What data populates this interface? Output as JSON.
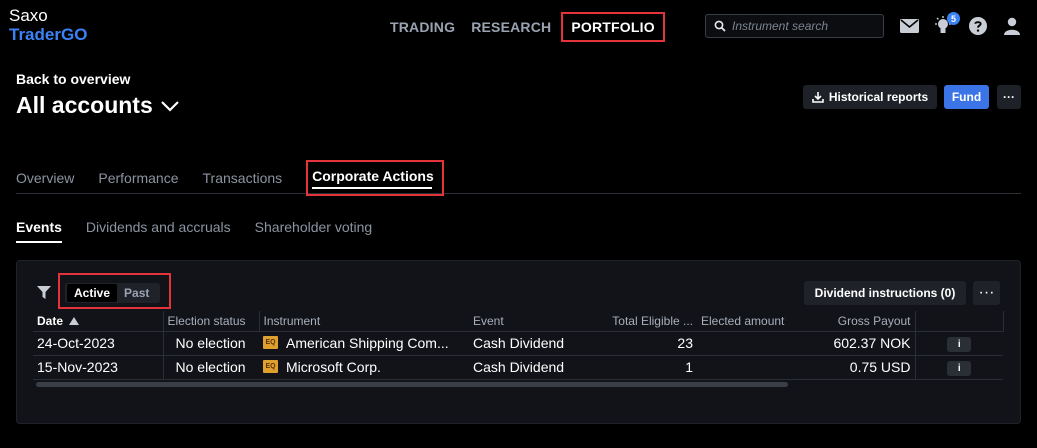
{
  "brand": {
    "line1": "Saxo",
    "line2": "TraderGO"
  },
  "topnav": {
    "items": [
      "TRADING",
      "RESEARCH",
      "PORTFOLIO"
    ],
    "active": "PORTFOLIO"
  },
  "search": {
    "placeholder": "Instrument search"
  },
  "notifications": {
    "count": "5"
  },
  "header": {
    "back": "Back to overview",
    "title": "All accounts"
  },
  "actions": {
    "historical": "Historical reports",
    "fund": "Fund",
    "more": "···"
  },
  "tabs": [
    "Overview",
    "Performance",
    "Transactions",
    "Corporate Actions"
  ],
  "subtabs": [
    "Events",
    "Dividends and accruals",
    "Shareholder voting"
  ],
  "filter": {
    "options": [
      "Active",
      "Past"
    ]
  },
  "toolbar": {
    "dividend_instructions": "Dividend instructions (0)",
    "more": "···"
  },
  "table": {
    "columns": [
      "Date",
      "Election status",
      "Instrument",
      "Event",
      "Total Eligible ...",
      "Elected amount",
      "Gross Payout"
    ],
    "rows": [
      {
        "date": "24-Oct-2023",
        "status": "No election",
        "badge": "EQ",
        "instrument": "American Shipping Com...",
        "event": "Cash Dividend",
        "eligible": "23",
        "elected": "",
        "payout": "602.37 NOK",
        "info": "i"
      },
      {
        "date": "15-Nov-2023",
        "status": "No election",
        "badge": "EQ",
        "instrument": "Microsoft Corp.",
        "event": "Cash Dividend",
        "eligible": "1",
        "elected": "",
        "payout": "0.75 USD",
        "info": "i"
      }
    ]
  },
  "colors": {
    "accent": "#3b82f6",
    "highlight": "#e5333a",
    "eq_badge": "#e0a030"
  }
}
